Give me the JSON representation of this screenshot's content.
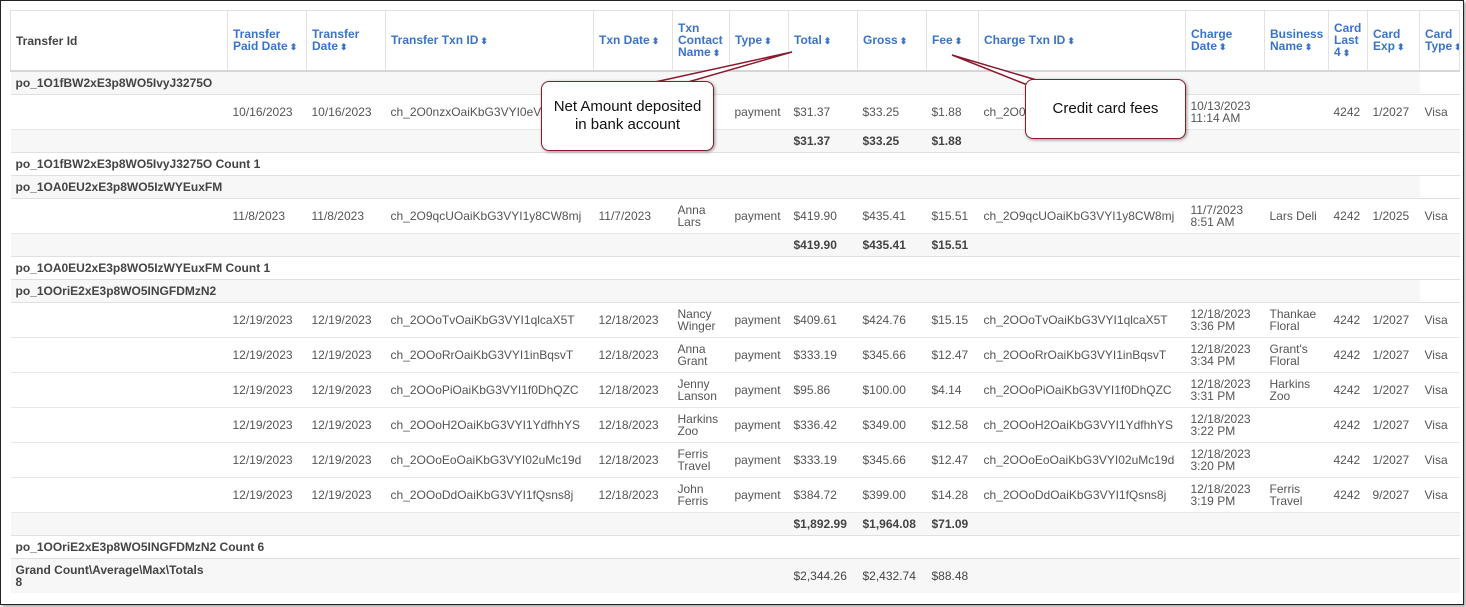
{
  "columns": [
    {
      "key": "transfer_id",
      "label": "Transfer Id",
      "sortable": false
    },
    {
      "key": "transfer_paid_date",
      "label": "Transfer Paid Date",
      "sortable": true
    },
    {
      "key": "transfer_date",
      "label": "Transfer Date",
      "sortable": true
    },
    {
      "key": "transfer_txn_id",
      "label": "Transfer Txn ID",
      "sortable": true
    },
    {
      "key": "txn_date",
      "label": "Txn Date",
      "sortable": true
    },
    {
      "key": "txn_contact_name",
      "label": "Txn Contact Name",
      "sortable": true
    },
    {
      "key": "type",
      "label": "Type",
      "sortable": true
    },
    {
      "key": "total",
      "label": "Total",
      "sortable": true
    },
    {
      "key": "gross",
      "label": "Gross",
      "sortable": true
    },
    {
      "key": "fee",
      "label": "Fee",
      "sortable": true
    },
    {
      "key": "charge_txn_id",
      "label": "Charge Txn ID",
      "sortable": true
    },
    {
      "key": "charge_date",
      "label": "Charge Date",
      "sortable": true
    },
    {
      "key": "business_name",
      "label": "Business Name",
      "sortable": true
    },
    {
      "key": "card_last4",
      "label": "Card Last 4",
      "sortable": true
    },
    {
      "key": "card_exp",
      "label": "Card Exp",
      "sortable": true
    },
    {
      "key": "card_type",
      "label": "Card Type",
      "sortable": true
    }
  ],
  "sort_glyph": "⬍",
  "groups": [
    {
      "id": "po_1O1fBW2xE3p8WO5IvyJ3275O",
      "count_label": "po_1O1fBW2xE3p8WO5IvyJ3275O Count 1",
      "rows": [
        [
          "",
          "10/16/2023",
          "10/16/2023",
          "ch_2O0nzxOaiKbG3VYI0eV",
          "",
          "",
          "payment",
          "$31.37",
          "$33.25",
          "$1.88",
          "ch_2O0",
          "10/13/2023 11:14 AM",
          "",
          "4242",
          "1/2027",
          "Visa"
        ]
      ],
      "subtotal": {
        "total": "$31.37",
        "gross": "$33.25",
        "fee": "$1.88"
      }
    },
    {
      "id": "po_1OA0EU2xE3p8WO5IzWYEuxFM",
      "count_label": "po_1OA0EU2xE3p8WO5IzWYEuxFM Count 1",
      "rows": [
        [
          "",
          "11/8/2023",
          "11/8/2023",
          "ch_2O9qcUOaiKbG3VYI1y8CW8mj",
          "11/7/2023",
          "Anna Lars",
          "payment",
          "$419.90",
          "$435.41",
          "$15.51",
          "ch_2O9qcUOaiKbG3VYI1y8CW8mj",
          "11/7/2023 8:51 AM",
          "Lars Deli",
          "4242",
          "1/2025",
          "Visa"
        ]
      ],
      "subtotal": {
        "total": "$419.90",
        "gross": "$435.41",
        "fee": "$15.51"
      }
    },
    {
      "id": "po_1OOriE2xE3p8WO5INGFDMzN2",
      "count_label": "po_1OOriE2xE3p8WO5INGFDMzN2 Count 6",
      "rows": [
        [
          "",
          "12/19/2023",
          "12/19/2023",
          "ch_2OOoTvOaiKbG3VYI1qlcaX5T",
          "12/18/2023",
          "Nancy Winger",
          "payment",
          "$409.61",
          "$424.76",
          "$15.15",
          "ch_2OOoTvOaiKbG3VYI1qlcaX5T",
          "12/18/2023 3:36 PM",
          "Thankae Floral",
          "4242",
          "1/2027",
          "Visa"
        ],
        [
          "",
          "12/19/2023",
          "12/19/2023",
          "ch_2OOoRrOaiKbG3VYI1inBqsvT",
          "12/18/2023",
          "Anna Grant",
          "payment",
          "$333.19",
          "$345.66",
          "$12.47",
          "ch_2OOoRrOaiKbG3VYI1inBqsvT",
          "12/18/2023 3:34 PM",
          "Grant's Floral",
          "4242",
          "1/2027",
          "Visa"
        ],
        [
          "",
          "12/19/2023",
          "12/19/2023",
          "ch_2OOoPiOaiKbG3VYI1f0DhQZC",
          "12/18/2023",
          "Jenny Lanson",
          "payment",
          "$95.86",
          "$100.00",
          "$4.14",
          "ch_2OOoPiOaiKbG3VYI1f0DhQZC",
          "12/18/2023 3:31 PM",
          "Harkins Zoo",
          "4242",
          "1/2027",
          "Visa"
        ],
        [
          "",
          "12/19/2023",
          "12/19/2023",
          "ch_2OOoH2OaiKbG3VYI1YdfhhYS",
          "12/18/2023",
          "Harkins Zoo",
          "payment",
          "$336.42",
          "$349.00",
          "$12.58",
          "ch_2OOoH2OaiKbG3VYI1YdfhhYS",
          "12/18/2023 3:22 PM",
          "",
          "4242",
          "1/2027",
          "Visa"
        ],
        [
          "",
          "12/19/2023",
          "12/19/2023",
          "ch_2OOoEoOaiKbG3VYI02uMc19d",
          "12/18/2023",
          "Ferris Travel",
          "payment",
          "$333.19",
          "$345.66",
          "$12.47",
          "ch_2OOoEoOaiKbG3VYI02uMc19d",
          "12/18/2023 3:20 PM",
          "",
          "4242",
          "1/2027",
          "Visa"
        ],
        [
          "",
          "12/19/2023",
          "12/19/2023",
          "ch_2OOoDdOaiKbG3VYI1fQsns8j",
          "12/18/2023",
          "John Ferris",
          "payment",
          "$384.72",
          "$399.00",
          "$14.28",
          "ch_2OOoDdOaiKbG3VYI1fQsns8j",
          "12/18/2023 3:19 PM",
          "Ferris Travel",
          "4242",
          "9/2027",
          "Visa"
        ]
      ],
      "subtotal": {
        "total": "$1,892.99",
        "gross": "$1,964.08",
        "fee": "$71.09"
      }
    }
  ],
  "grand": {
    "label": "Grand Count\\Average\\Max\\Totals",
    "count": "8",
    "total": "$2,344.26",
    "gross": "$2,432.74",
    "fee": "$88.48"
  },
  "callouts": {
    "net_amount": "Net Amount deposited in bank account",
    "credit_fees": "Credit card fees"
  },
  "colors": {
    "header_link": "#3a74c9",
    "callout_border": "#8a1a2e"
  }
}
